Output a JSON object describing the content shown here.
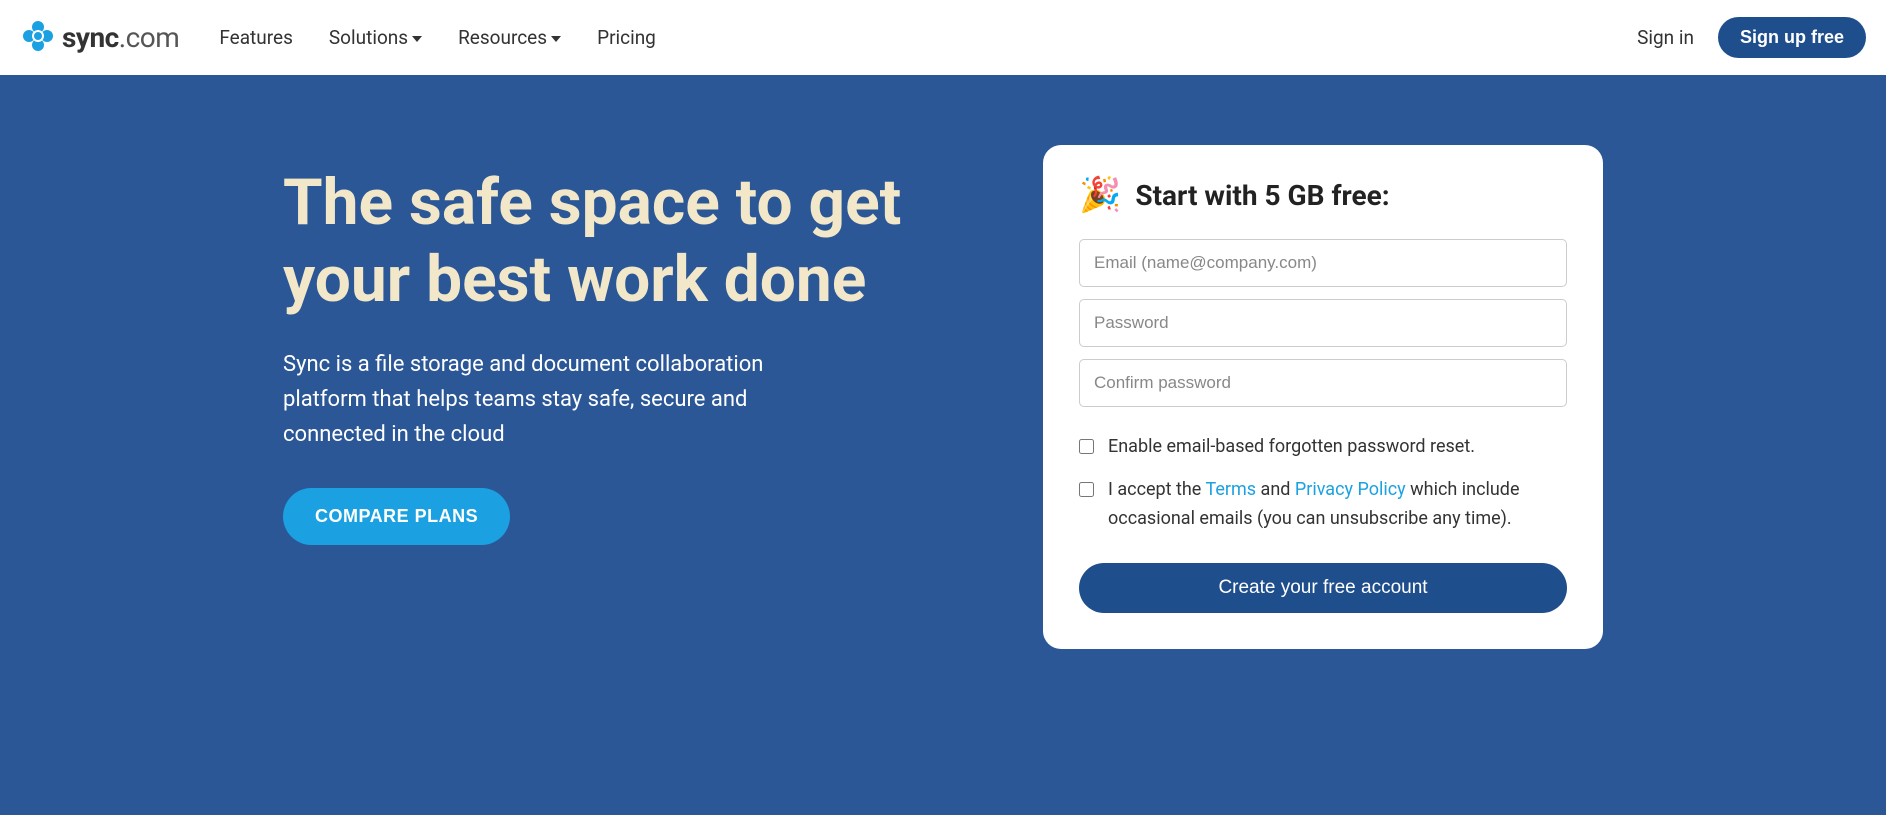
{
  "logo": {
    "bold": "sync",
    "light": ".com"
  },
  "nav": {
    "features": "Features",
    "solutions": "Solutions",
    "resources": "Resources",
    "pricing": "Pricing"
  },
  "header": {
    "signin": "Sign in",
    "signup": "Sign up free"
  },
  "hero": {
    "title": "The safe space to get your best work done",
    "subtitle": "Sync is a file storage and document collaboration platform that helps teams stay safe, secure and connected in the cloud",
    "compare_btn": "COMPARE PLANS"
  },
  "form": {
    "title": "Start with 5 GB free:",
    "email_placeholder": "Email (name@company.com)",
    "password_placeholder": "Password",
    "confirm_placeholder": "Confirm password",
    "enable_reset": "Enable email-based forgotten password reset.",
    "accept_prefix": "I accept the ",
    "terms": "Terms",
    "and": " and ",
    "privacy": "Privacy Policy",
    "accept_suffix": " which include occasional emails (you can unsubscribe any time).",
    "create_btn": "Create your free account"
  }
}
